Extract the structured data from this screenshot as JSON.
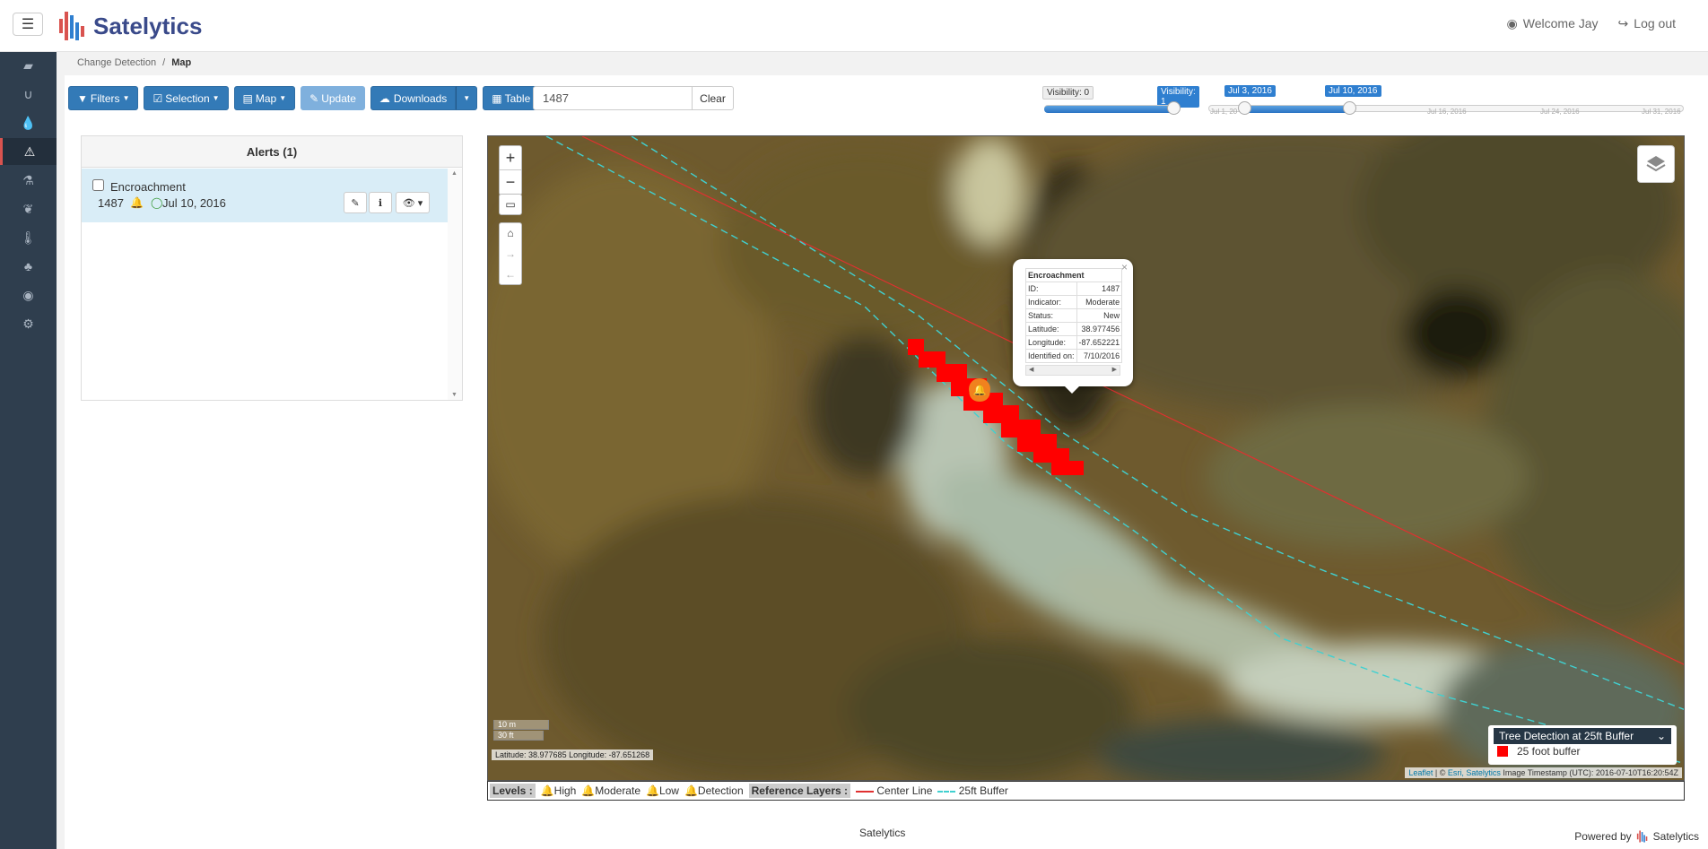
{
  "app": {
    "brand": "Satelytics",
    "welcome": "Welcome Jay",
    "logout": "Log out"
  },
  "breadcrumb": {
    "parent": "Change Detection",
    "separator": "/",
    "current": "Map"
  },
  "toolbar": {
    "filters": "Filters",
    "selection": "Selection",
    "map": "Map",
    "update": "Update",
    "downloads": "Downloads",
    "table_view": "Table View",
    "search_value": "1487",
    "clear": "Clear"
  },
  "visibility_slider": {
    "label_min": "Visibility: 0",
    "label_value": "Visibility: 1",
    "value": 1,
    "max": 1
  },
  "time_slider": {
    "start_label": "Jul 3, 2016",
    "end_label": "Jul 10, 2016",
    "ticks": [
      "Jul 1, 20",
      "Jul 16, 2016",
      "Jul 24, 2016",
      "Jul 31, 2016"
    ]
  },
  "alerts": {
    "title": "Alerts (1)",
    "items": [
      {
        "type": "Encroachment",
        "id": "1487",
        "date": "Jul 10, 2016",
        "level_color": "#f0821e"
      }
    ]
  },
  "popup": {
    "title": "Encroachment",
    "rows": [
      {
        "k": "ID:",
        "v": "1487"
      },
      {
        "k": "Indicator:",
        "v": "Moderate"
      },
      {
        "k": "Status:",
        "v": "New"
      },
      {
        "k": "Latitude:",
        "v": "38.977456"
      },
      {
        "k": "Longitude:",
        "v": "-87.652221"
      },
      {
        "k": "Identified on:",
        "v": "7/10/2016"
      }
    ]
  },
  "map": {
    "scale_m": "10 m",
    "scale_ft": "30 ft",
    "coords": "Latitude: 38.977685 Longitude: -87.651268",
    "legend_title": "Tree Detection at 25ft Buffer",
    "legend_item": "25 foot buffer",
    "attribution": {
      "leaflet": "Leaflet",
      "sep": " | © ",
      "esri": "Esri, Satelytics",
      "timestamp": "Image Timestamp (UTC): 2016-07-10T16:20:54Z"
    }
  },
  "levels_bar": {
    "levels_label": "Levels :",
    "high": "High",
    "moderate": "Moderate",
    "low": "Low",
    "detection": "Detection",
    "ref_label": "Reference Layers :",
    "center_line": "Center Line",
    "buffer": "25ft Buffer"
  },
  "footer": {
    "center": "Satelytics",
    "powered": "Powered by",
    "brand": "Satelytics"
  },
  "colors": {
    "primary": "#337ab7",
    "sidebar": "#2f3e4e",
    "high": "#d9534f",
    "moderate": "#f0821e",
    "low": "#2f7fd0",
    "detection": "#222222",
    "center_line": "#e03030",
    "buffer_line": "#40d0d0"
  }
}
